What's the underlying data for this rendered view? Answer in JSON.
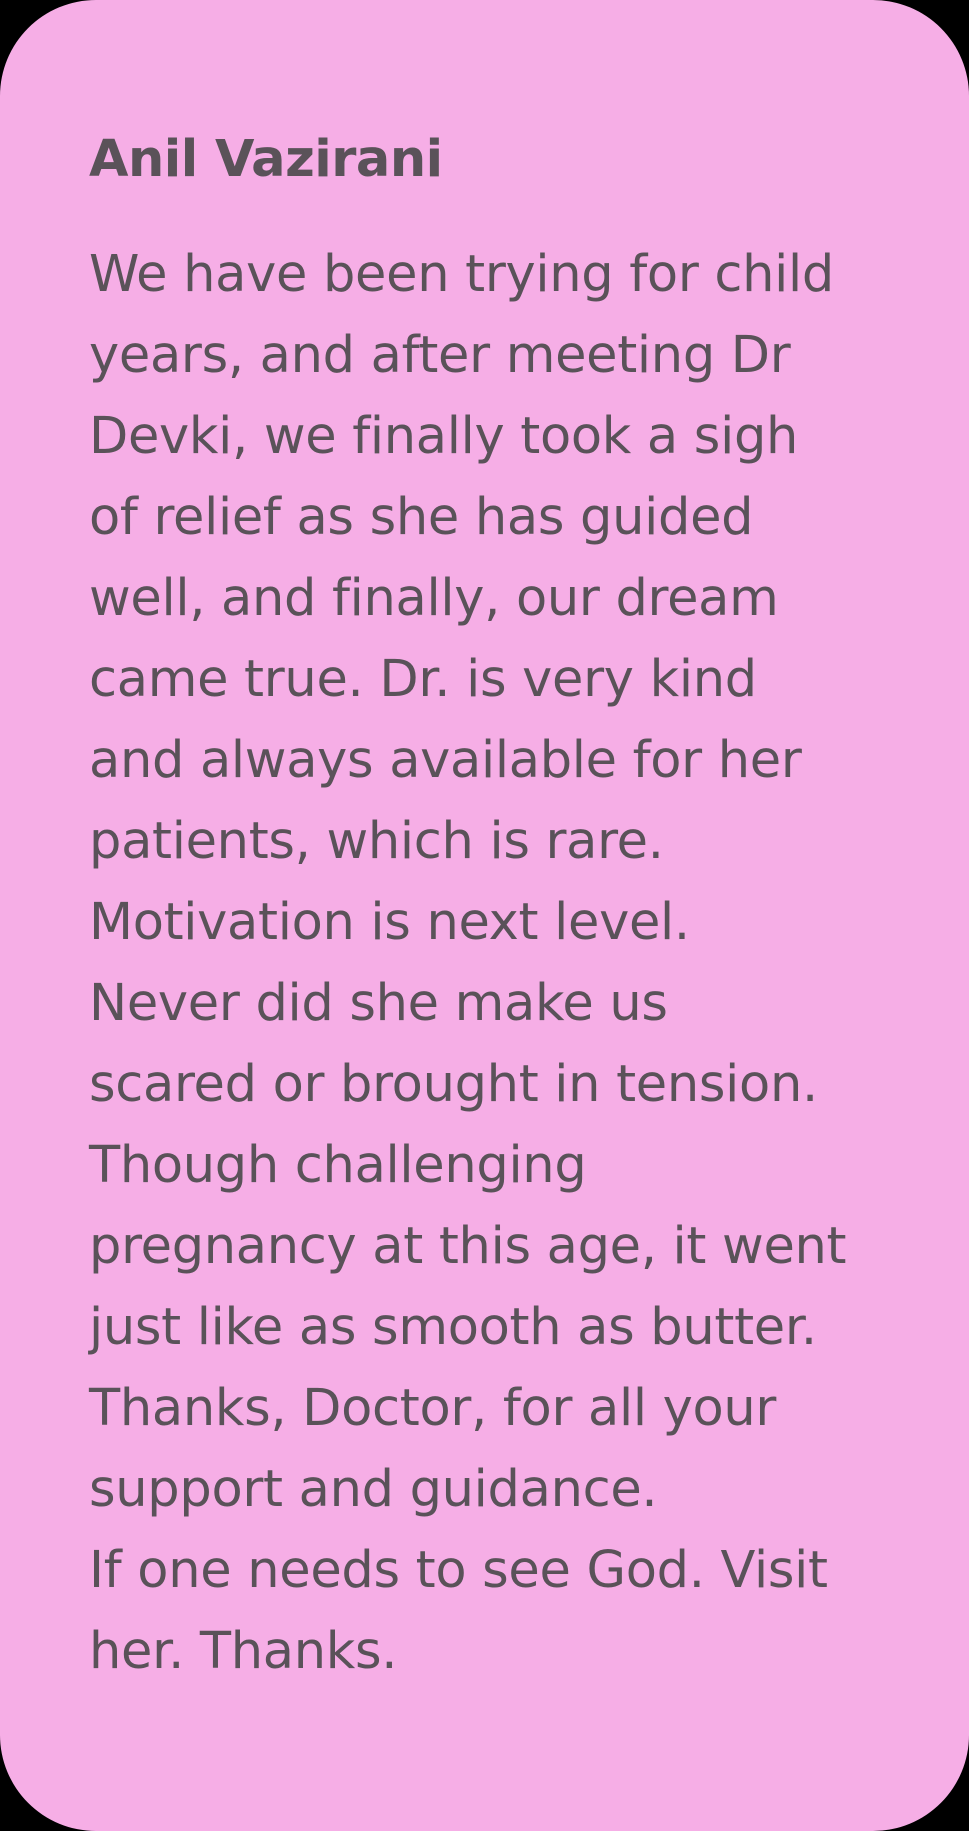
{
  "testimonial": {
    "author": "Anil Vazirani",
    "lines": [
      "We have been trying for child",
      "years, and after meeting Dr",
      "Devki, we finally took a sigh",
      "of relief as she has guided",
      "well, and finally, our dream",
      "came true. Dr. is very kind",
      "and always available for her",
      "patients, which is rare.",
      "Motivation is next level.",
      "Never did she make us",
      "scared or brought in tension.",
      "Though challenging",
      "pregnancy at this age, it went",
      "just like as smooth as butter.",
      "Thanks, Doctor, for all your",
      "support and guidance.",
      "If one needs to see God. Visit",
      "her. Thanks."
    ]
  },
  "colors": {
    "card_background": "#f6aee6",
    "text": "#5a5259",
    "outer_background": "#000000"
  }
}
